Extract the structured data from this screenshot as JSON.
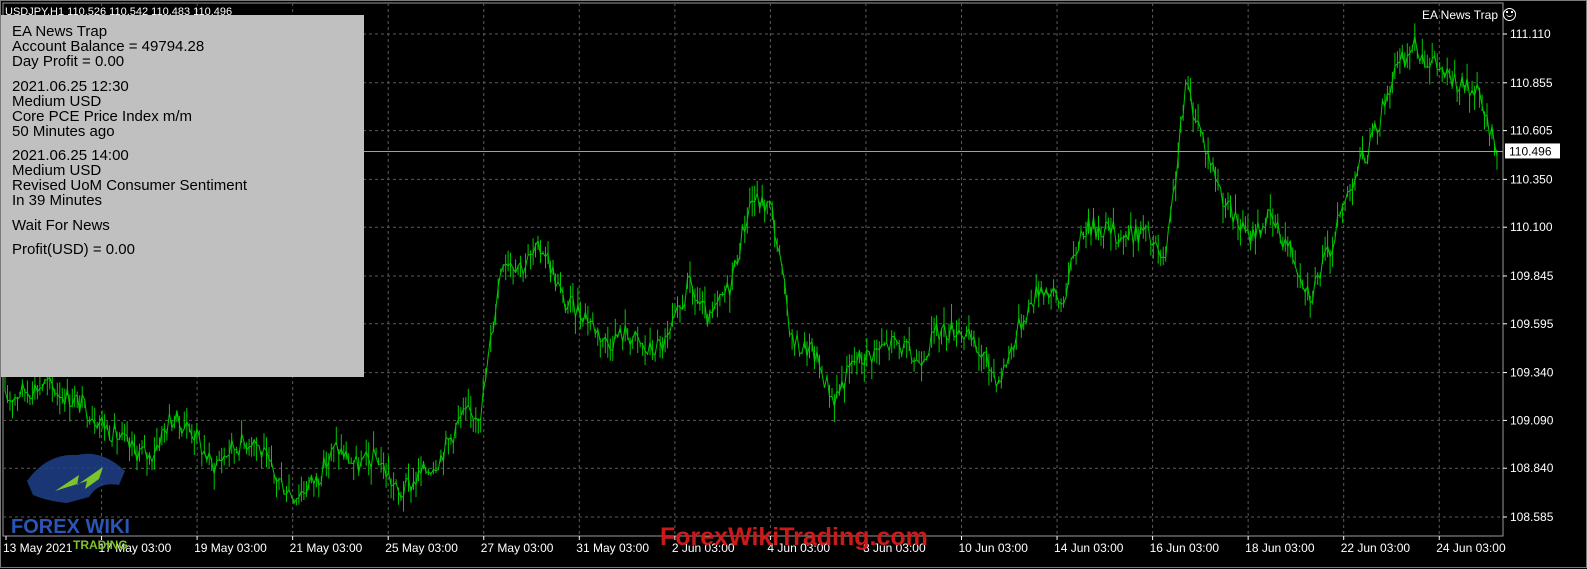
{
  "symbol_line": "USDJPY,H1  110.526 110.542 110.483 110.496",
  "ea_label": "EA News Trap",
  "info_panel": {
    "title": "EA News Trap",
    "account_balance": "Account Balance = 49794.28",
    "day_profit": "Day Profit = 0.00",
    "news1_time": "2021.06.25 12:30",
    "news1_impact": "Medium USD",
    "news1_title": "Core PCE Price Index m/m",
    "news1_when": "50 Minutes ago",
    "news2_time": "2021.06.25 14:00",
    "news2_impact": "Medium USD",
    "news2_title": "Revised UoM Consumer Sentiment",
    "news2_when": "In 39 Minutes",
    "status": "Wait For News",
    "profit": "Profit(USD) = 0.00"
  },
  "watermark": "ForexWikiTrading.com",
  "logo": {
    "text_top": "FOREX WIKI",
    "text_bottom": "TRADING"
  },
  "colors": {
    "candle": "#00c800",
    "background": "#000000",
    "grid": "#5a5a5a",
    "panel": "#c0c0c0",
    "watermark": "#cc1a1a"
  },
  "chart_data": {
    "type": "line",
    "symbol": "USDJPY",
    "timeframe": "H1",
    "current_price": 110.496,
    "y_ticks": [
      111.11,
      110.855,
      110.605,
      110.35,
      110.1,
      109.845,
      109.595,
      109.34,
      109.09,
      108.84,
      108.585
    ],
    "y_tick_labels": [
      "111.110",
      "110.855",
      "110.605",
      "110.350",
      "110.100",
      "109.845",
      "109.595",
      "109.340",
      "109.090",
      "108.840",
      "108.585"
    ],
    "ylim": [
      108.55,
      111.18
    ],
    "x_labels": [
      "13 May 2021",
      "17 May 03:00",
      "19 May 03:00",
      "21 May 03:00",
      "25 May 03:00",
      "27 May 03:00",
      "31 May 03:00",
      "2 Jun 03:00",
      "4 Jun 03:00",
      "8 Jun 03:00",
      "10 Jun 03:00",
      "14 Jun 03:00",
      "16 Jun 03:00",
      "18 Jun 03:00",
      "22 Jun 03:00",
      "24 Jun 03:00"
    ],
    "grid": true,
    "series": [
      {
        "values": [
          109.2,
          109.25,
          109.28,
          109.22,
          109.15,
          109.05,
          108.95,
          108.9,
          109.1,
          109.05,
          108.85,
          108.95,
          109.0,
          108.8,
          108.7,
          108.78,
          108.95,
          108.85,
          108.9,
          108.7,
          108.8,
          108.9,
          109.1,
          109.15,
          109.95,
          109.9,
          110.0,
          109.7,
          109.65,
          109.5,
          109.55,
          109.45,
          109.5,
          109.8,
          109.6,
          109.8,
          110.25,
          110.2,
          109.5,
          109.45,
          109.2,
          109.4,
          109.45,
          109.5,
          109.4,
          109.55,
          109.58,
          109.45,
          109.3,
          109.6,
          109.8,
          109.7,
          110.1,
          110.1,
          110.05,
          110.08,
          109.9,
          110.85,
          110.5,
          110.2,
          110.05,
          110.15,
          110.0,
          109.75,
          110.0,
          110.35,
          110.55,
          110.9,
          111.05,
          110.95,
          110.85,
          110.8,
          110.5
        ]
      }
    ]
  }
}
